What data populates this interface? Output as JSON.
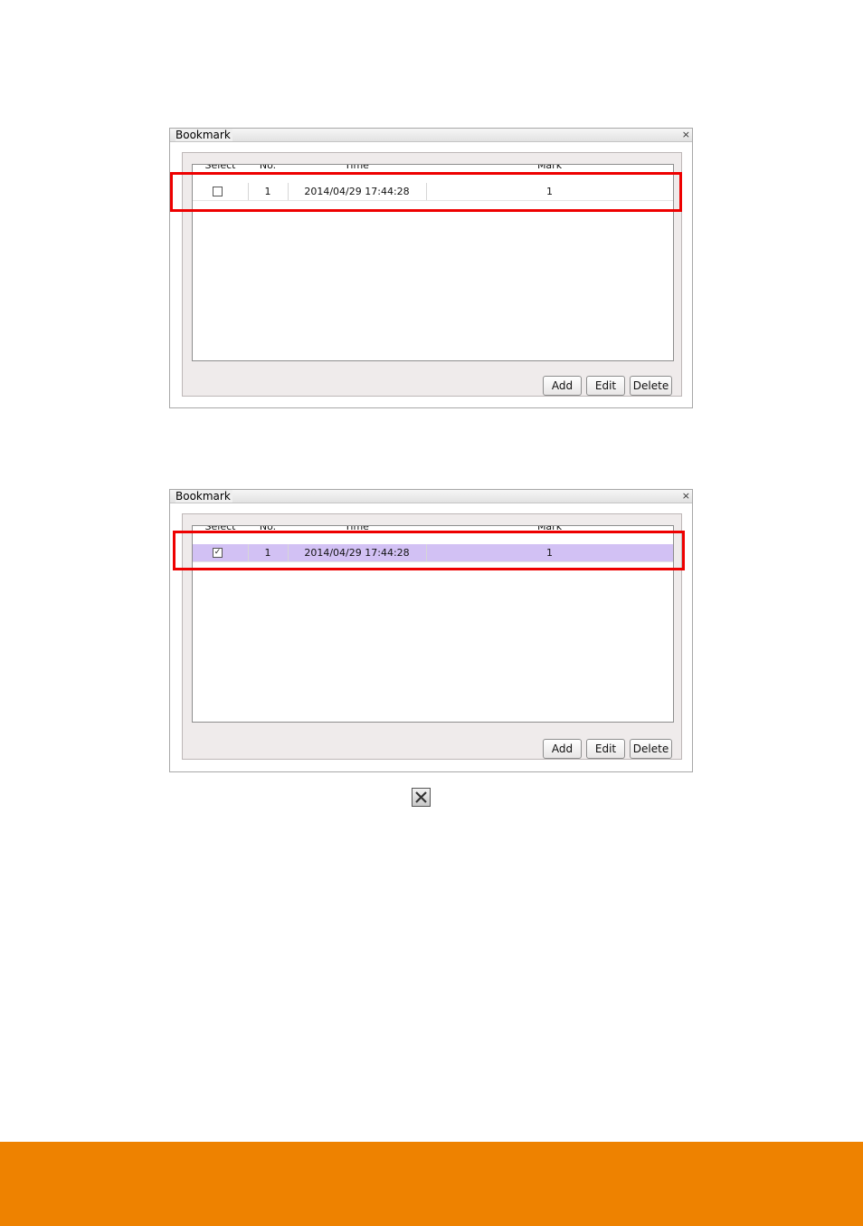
{
  "dialogs": [
    {
      "title": "Bookmark",
      "close_glyph": "×",
      "columns": [
        "Select",
        "No.",
        "Time",
        "Mark"
      ],
      "rows": [
        {
          "selected": false,
          "checkbox_glyph": "",
          "no": "1",
          "time": "2014/04/29  17:44:28",
          "mark": "1"
        }
      ],
      "buttons": {
        "add": "Add",
        "edit": "Edit",
        "delete": "Delete"
      }
    },
    {
      "title": "Bookmark",
      "close_glyph": "×",
      "columns": [
        "Select",
        "No.",
        "Time",
        "Mark"
      ],
      "rows": [
        {
          "selected": true,
          "checkbox_glyph": "✓",
          "no": "1",
          "time": "2014/04/29  17:44:28",
          "mark": "1"
        }
      ],
      "buttons": {
        "add": "Add",
        "edit": "Edit",
        "delete": "Delete"
      }
    }
  ],
  "highlight_color": "#ee0000",
  "selected_row_color": "#d2c1f4",
  "footer_color": "#ee8200",
  "close_button_icon": "close-x-icon"
}
